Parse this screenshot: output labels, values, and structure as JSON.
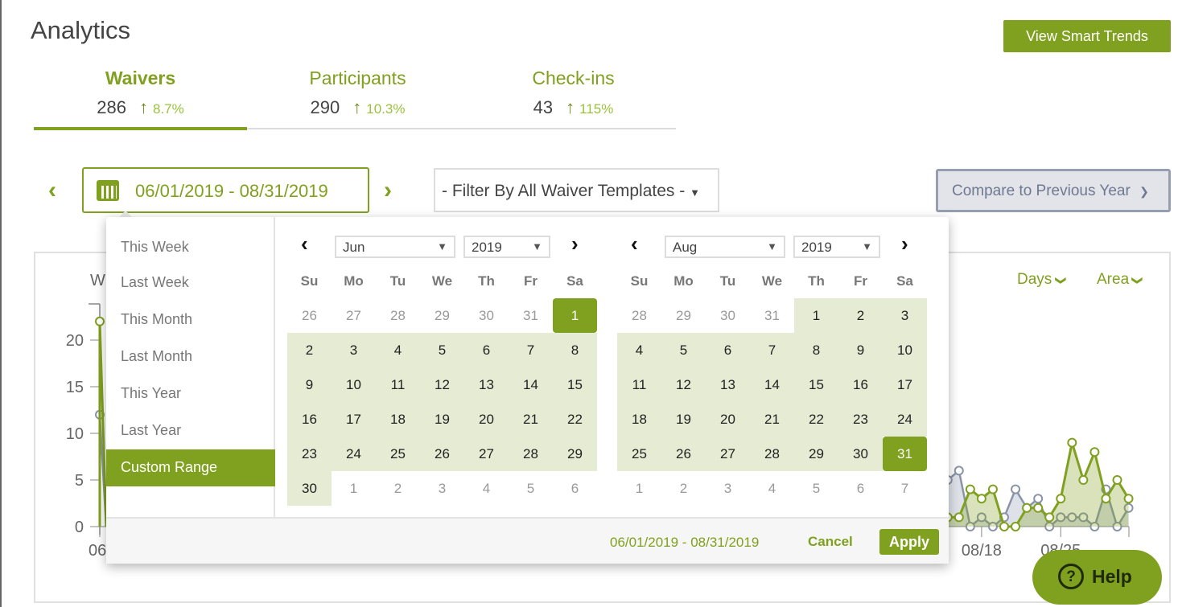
{
  "page": {
    "title": "Analytics",
    "smart_trends_label": "View Smart Trends"
  },
  "tabs": [
    {
      "label": "Waivers",
      "value": "286",
      "change": "8.7%",
      "active": true
    },
    {
      "label": "Participants",
      "value": "290",
      "change": "10.3%",
      "active": false
    },
    {
      "label": "Check-ins",
      "value": "43",
      "change": "115%",
      "active": false
    }
  ],
  "toolbar": {
    "date_range": "06/01/2019 - 08/31/2019",
    "template_filter": "- Filter By All Waiver Templates -",
    "compare_label": "Compare to Previous Year"
  },
  "chart_controls": {
    "interval": "Days",
    "type": "Area"
  },
  "colors": {
    "accent": "#80a01f",
    "range_bg": "#e6ebd3",
    "previous_series": "#8a93a8"
  },
  "datepicker": {
    "ranges": [
      "This Week",
      "Last Week",
      "This Month",
      "Last Month",
      "This Year",
      "Last Year",
      "Custom Range"
    ],
    "active_range": "Custom Range",
    "weekdays": [
      "Su",
      "Mo",
      "Tu",
      "We",
      "Th",
      "Fr",
      "Sa"
    ],
    "months": [
      {
        "month": "Jun",
        "year": "2019",
        "selected": "1",
        "weeks": [
          [
            "26",
            "27",
            "28",
            "29",
            "30",
            "31",
            "1"
          ],
          [
            "2",
            "3",
            "4",
            "5",
            "6",
            "7",
            "8"
          ],
          [
            "9",
            "10",
            "11",
            "12",
            "13",
            "14",
            "15"
          ],
          [
            "16",
            "17",
            "18",
            "19",
            "20",
            "21",
            "22"
          ],
          [
            "23",
            "24",
            "25",
            "26",
            "27",
            "28",
            "29"
          ],
          [
            "30",
            "1",
            "2",
            "3",
            "4",
            "5",
            "6"
          ]
        ]
      },
      {
        "month": "Aug",
        "year": "2019",
        "selected": "31",
        "weeks": [
          [
            "28",
            "29",
            "30",
            "31",
            "1",
            "2",
            "3"
          ],
          [
            "4",
            "5",
            "6",
            "7",
            "8",
            "9",
            "10"
          ],
          [
            "11",
            "12",
            "13",
            "14",
            "15",
            "16",
            "17"
          ],
          [
            "18",
            "19",
            "20",
            "21",
            "22",
            "23",
            "24"
          ],
          [
            "25",
            "26",
            "27",
            "28",
            "29",
            "30",
            "31"
          ],
          [
            "1",
            "2",
            "3",
            "4",
            "5",
            "6",
            "7"
          ]
        ]
      }
    ],
    "footer_range": "06/01/2019 - 08/31/2019",
    "cancel_label": "Cancel",
    "apply_label": "Apply"
  },
  "help_label": "Help",
  "chart_data": {
    "type": "area",
    "title": "W",
    "y_ticks": [
      "0",
      "5",
      "10",
      "15",
      "20"
    ],
    "ylim": [
      0,
      24
    ],
    "x_range": [
      "06/01",
      "08/31"
    ],
    "x_tick_labels": [
      {
        "date": "06/01",
        "label": "06"
      },
      {
        "date": "08/18",
        "label": "08/18"
      },
      {
        "date": "08/25",
        "label": "08/25"
      }
    ],
    "series": [
      {
        "color": "#80a01f",
        "points": [
          [
            "06/01",
            22
          ],
          [
            "08/15",
            1
          ],
          [
            "08/16",
            1
          ],
          [
            "08/17",
            4
          ],
          [
            "08/18",
            3
          ],
          [
            "08/19",
            4
          ],
          [
            "08/20",
            0
          ],
          [
            "08/21",
            0
          ],
          [
            "08/22",
            2
          ],
          [
            "08/23",
            2
          ],
          [
            "08/24",
            1
          ],
          [
            "08/25",
            3
          ],
          [
            "08/26",
            9
          ],
          [
            "08/27",
            5
          ],
          [
            "08/28",
            8
          ],
          [
            "08/29",
            3
          ],
          [
            "08/30",
            5
          ],
          [
            "08/31",
            3
          ]
        ]
      },
      {
        "color": "#8a93a8",
        "points": [
          [
            "06/01",
            12
          ],
          [
            "08/15",
            5
          ],
          [
            "08/16",
            6
          ],
          [
            "08/17",
            0
          ],
          [
            "08/18",
            1
          ],
          [
            "08/19",
            0
          ],
          [
            "08/20",
            1
          ],
          [
            "08/21",
            4
          ],
          [
            "08/22",
            2
          ],
          [
            "08/23",
            3
          ],
          [
            "08/24",
            0
          ],
          [
            "08/25",
            1
          ],
          [
            "08/26",
            1
          ],
          [
            "08/27",
            1
          ],
          [
            "08/28",
            0
          ],
          [
            "08/29",
            4
          ],
          [
            "08/30",
            0
          ],
          [
            "08/31",
            2
          ]
        ]
      }
    ]
  }
}
